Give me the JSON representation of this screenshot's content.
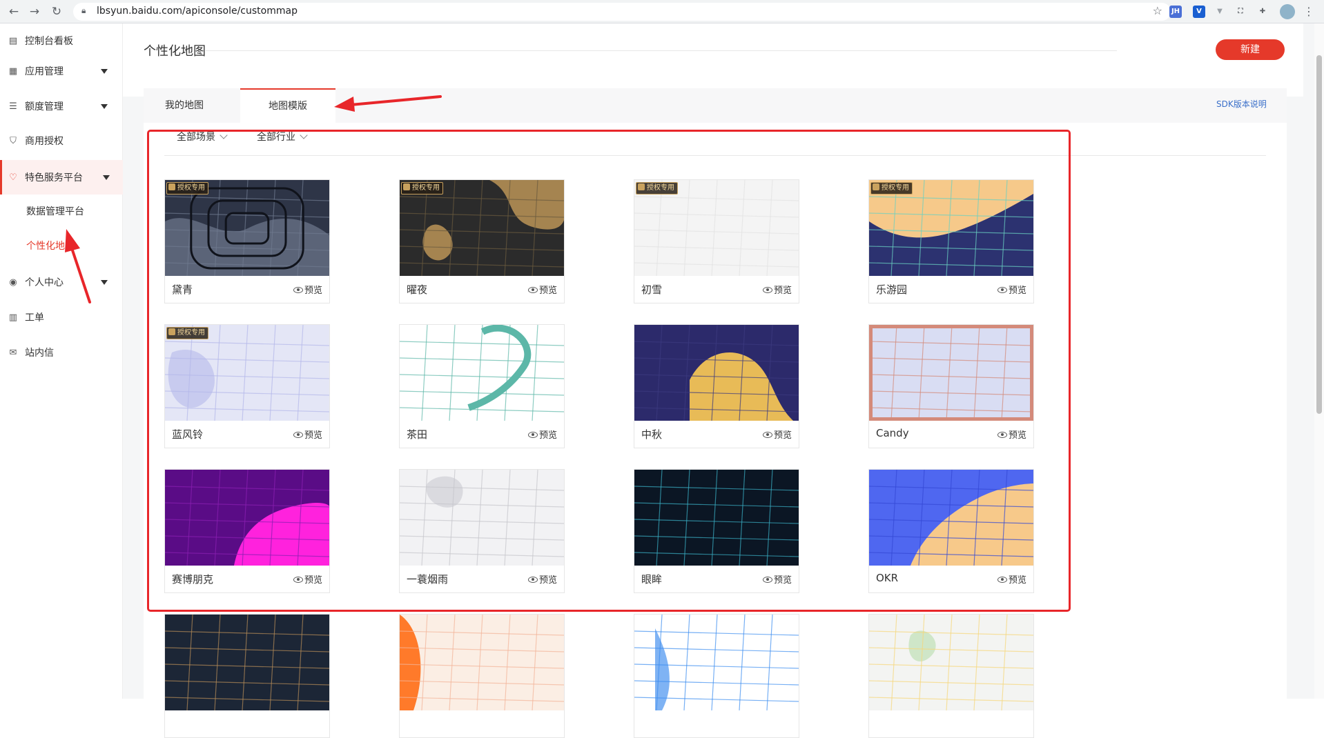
{
  "browser": {
    "url": "lbsyun.baidu.com/apiconsole/custommap",
    "extensions": [
      {
        "name": "jh-extension-icon",
        "label": "JH",
        "color": "#4a6fd6"
      },
      {
        "name": "v-extension-icon",
        "label": "V",
        "color": "#1a5fd1"
      },
      {
        "name": "filter-extension-icon",
        "label": "",
        "color": "#9aa0a6"
      },
      {
        "name": "capture-extension-icon",
        "label": "",
        "color": "#5f6368"
      },
      {
        "name": "puzzle-extension-icon",
        "label": "",
        "color": "#5f6368"
      }
    ]
  },
  "sidebar": {
    "items": [
      {
        "label": "控制台看板",
        "icon": "dashboard-icon"
      },
      {
        "label": "应用管理",
        "icon": "grid-icon"
      },
      {
        "label": "额度管理",
        "icon": "sliders-icon"
      },
      {
        "label": "商用授权",
        "icon": "shield-icon"
      },
      {
        "label": "特色服务平台",
        "icon": "heart-shield-icon"
      },
      {
        "label": "个人中心",
        "icon": "user-circle-icon"
      },
      {
        "label": "工单",
        "icon": "clipboard-icon"
      },
      {
        "label": "站内信",
        "icon": "mail-icon"
      }
    ],
    "sub_items": [
      {
        "label": "数据管理平台"
      },
      {
        "label": "个性化地图"
      }
    ]
  },
  "main": {
    "title": "个性化地图",
    "new_button": "新建",
    "tabs": [
      {
        "label": "我的地图"
      },
      {
        "label": "地图模版"
      }
    ],
    "sdk_link": "SDK版本说明",
    "filters": [
      {
        "label": "全部场景"
      },
      {
        "label": "全部行业"
      }
    ],
    "preview_label": "预览",
    "badge_label": "授权专用",
    "templates": [
      {
        "name": "黛青",
        "licensed": true,
        "bg": "#2e3547",
        "fg": "#5b6478",
        "accent": "#6f7a8f"
      },
      {
        "name": "曜夜",
        "licensed": true,
        "bg": "#2b2b2b",
        "fg": "#a58450",
        "accent": "#6a5a3e"
      },
      {
        "name": "初雪",
        "licensed": true,
        "bg": "#f4f4f4",
        "fg": "#cfcfcf",
        "accent": "#e2e2e2"
      },
      {
        "name": "乐游园",
        "licensed": true,
        "bg": "#f6c98a",
        "fg": "#2c3270",
        "accent": "#6ad1c2"
      },
      {
        "name": "蓝风铃",
        "licensed": true,
        "bg": "#e4e6f6",
        "fg": "#c8cbef",
        "accent": "#b4b8ea"
      },
      {
        "name": "茶田",
        "licensed": false,
        "bg": "#ffffff",
        "fg": "#cfe8d4",
        "accent": "#5cb7a8"
      },
      {
        "name": "中秋",
        "licensed": false,
        "bg": "#2c2a6b",
        "fg": "#e8bb57",
        "accent": "#3c3a80"
      },
      {
        "name": "Candy",
        "licensed": false,
        "bg": "#d9ddf3",
        "fg": "#b7bfe7",
        "accent": "#d48a7a"
      },
      {
        "name": "赛博朋克",
        "licensed": false,
        "bg": "#5a0c86",
        "fg": "#ff22dd",
        "accent": "#8a1fb1"
      },
      {
        "name": "一蓑烟雨",
        "licensed": false,
        "bg": "#f2f2f4",
        "fg": "#dadadf",
        "accent": "#c6c6cc"
      },
      {
        "name": "眼眸",
        "licensed": false,
        "bg": "#0b1624",
        "fg": "#1a2a3e",
        "accent": "#3ab0c6"
      },
      {
        "name": "OKR",
        "licensed": false,
        "bg": "#4f67f0",
        "fg": "#f7c98a",
        "accent": "#3449d6"
      },
      {
        "name": "",
        "licensed": false,
        "bg": "#1c2636",
        "fg": "#3a4659",
        "accent": "#b58b57"
      },
      {
        "name": "",
        "licensed": false,
        "bg": "#fbeee4",
        "fg": "#ff7a2a",
        "accent": "#f3b59a"
      },
      {
        "name": "",
        "licensed": false,
        "bg": "#ffffff",
        "fg": "#7fb3f4",
        "accent": "#3d8ef0"
      },
      {
        "name": "",
        "licensed": false,
        "bg": "#f3f4f2",
        "fg": "#cfe6c8",
        "accent": "#f6d77a"
      }
    ]
  },
  "colors": {
    "brand": "#e5392a",
    "annotation": "#e8262a",
    "link": "#3a6fc9"
  }
}
